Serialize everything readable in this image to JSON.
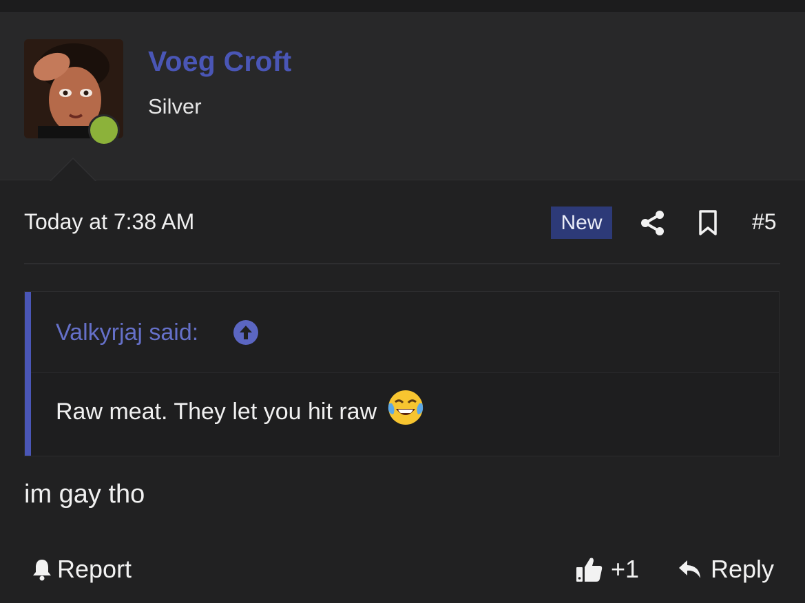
{
  "user": {
    "name": "Voeg Croft",
    "title": "Silver",
    "status_color": "#8cb23a",
    "name_color": "#4a56b6"
  },
  "post": {
    "time": "Today at 7:38 AM",
    "badge": "New",
    "number": "#5",
    "body": "im gay tho",
    "icons": {
      "share": "share-icon",
      "bookmark": "bookmark-icon"
    }
  },
  "quote": {
    "author": "Valkyrjaj said:",
    "text": "Raw meat. They let you hit raw",
    "emoji": "face-with-tears-of-joy",
    "jump_icon": "arrow-up-circle-icon"
  },
  "footer": {
    "report_label": "Report",
    "like_label": "+1",
    "reply_label": "Reply"
  }
}
